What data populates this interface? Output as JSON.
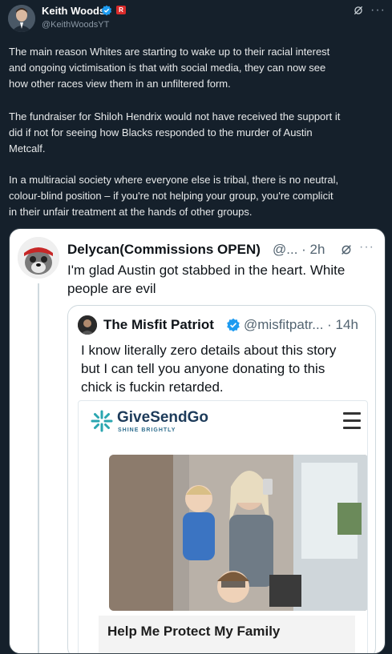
{
  "post": {
    "author_name": "Keith Woods",
    "author_handle": "@KeithWoodsYT",
    "paragraphs": [
      [
        "The main reason Whites are starting to wake up to their racial interest",
        "and ongoing victimisation is that with social media, they can now see",
        "how other races view them in an unfiltered form."
      ],
      [
        "The fundraiser for Shiloh Hendrix would not have received the support it",
        "did if not for seeing how Blacks responded to the murder of Austin",
        "Metcalf."
      ],
      [
        "In a multiracial society where everyone else is tribal, there is no neutral,",
        "colour-blind position – if you're not helping your group, you're complicit",
        "in their unfair treatment at the hands of other groups."
      ]
    ]
  },
  "quote": {
    "name": "Delycan(Commissions OPEN)",
    "handle_time": "@... · 2h",
    "text_lines": [
      "I'm glad Austin got stabbed in the heart. White",
      "people are evil"
    ]
  },
  "inner_quote": {
    "name": "The Misfit Patriot",
    "handle_time": "@misfitpatr... · 14h",
    "text_lines": [
      "I know literally zero details about this story",
      "but I can tell you anyone donating to this",
      "chick is fuckin retarded."
    ]
  },
  "givesendgo": {
    "brand": "GiveSendGo",
    "tagline": "SHINE BRIGHTLY",
    "campaign_title": "Help Me Protect My Family"
  },
  "icons": {
    "verified": "verified-badge-icon",
    "grok": "grok-icon",
    "more": "more-icon",
    "menu": "hamburger-menu-icon"
  },
  "colors": {
    "background": "#15202b",
    "verified_blue": "#1d9bf0",
    "brand_teal": "#2aa6b0"
  }
}
